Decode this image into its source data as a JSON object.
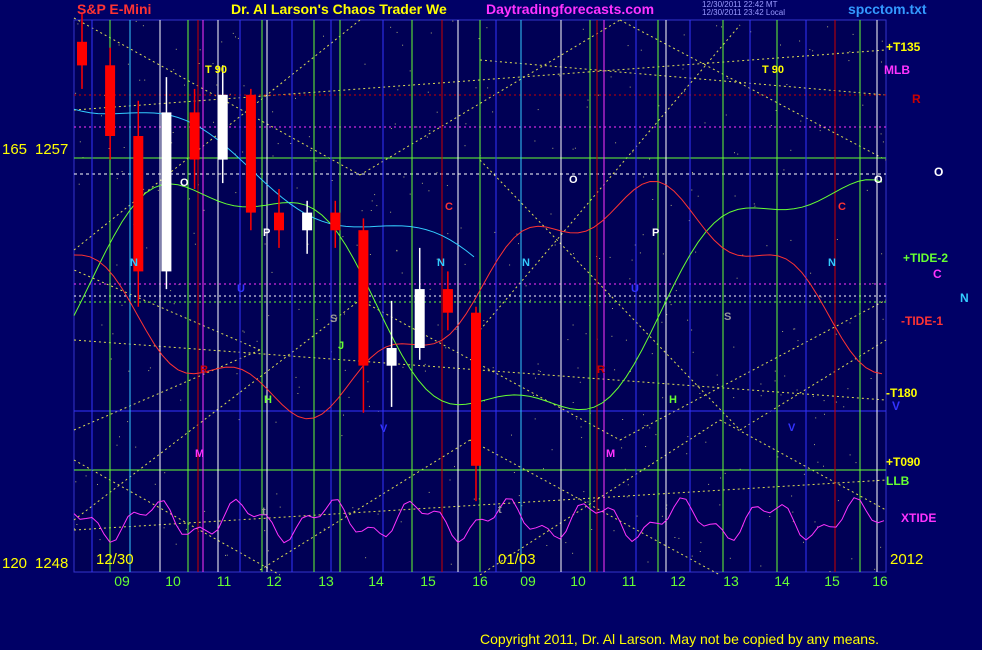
{
  "header": {
    "symbol": "S&P E-Mini",
    "title": "Dr. Al Larson's Chaos Trader We",
    "site": "Daytradingforecasts.com",
    "timestamp_1": "12/30/2011 22:42 MT",
    "timestamp_2": "12/30/2011 23:42 Local",
    "file": "spcctom.txt"
  },
  "y_axis": {
    "top_label_left": "165",
    "top_label_price": "1257",
    "bottom_label_left": "120",
    "bottom_label_price": "1248"
  },
  "footer": {
    "copyright": "Copyright 2011, Dr. Al Larson. May not be copied by any means."
  },
  "right_labels": {
    "t135": "+T135",
    "mlb": "MLB",
    "r": "R",
    "o": "O",
    "tide2": "+TIDE-2",
    "c": "C",
    "n": "N",
    "tide1": "-TIDE-1",
    "t180": "-T180",
    "v": "V",
    "t090": "+T090",
    "llb": "LLB",
    "xtide": "XTIDE"
  },
  "colors": {
    "background": "#000066",
    "plot_bg": "#000055",
    "axis_days": "#66ff33",
    "dates": "#ffff00",
    "header_red": "#ff3333",
    "header_yellow": "#ffff00",
    "header_magenta": "#ff33ff",
    "file_blue": "#3399ff"
  },
  "chart_data": {
    "type": "line",
    "title": "S&P E-Mini",
    "x_tick_labels": [
      "09",
      "10",
      "11",
      "12",
      "13",
      "14",
      "15",
      "16",
      "09",
      "10",
      "11",
      "12",
      "13",
      "14",
      "15",
      "16"
    ],
    "date_labels": [
      "12/30",
      "01/03",
      "2012"
    ],
    "y_range": [
      1248,
      1257
    ],
    "series": [
      {
        "name": "+TIDE-2"
      },
      {
        "name": "-TIDE-1"
      },
      {
        "name": "XTIDE"
      }
    ],
    "flux_line_labels": [
      "+T135",
      "MLB",
      "R",
      "O",
      "+TIDE-2",
      "C",
      "N",
      "-TIDE-1",
      "-T180",
      "V",
      "+T090",
      "LLB",
      "XTIDE"
    ],
    "cycle_letters_day1": [
      "T 90",
      "N",
      "U",
      "P",
      "S",
      "J",
      "R",
      "H",
      "M",
      "V",
      "t",
      "O",
      "C",
      "N"
    ],
    "cycle_letters_day2": [
      "T 90",
      "N",
      "U",
      "P",
      "S",
      "R",
      "H",
      "M",
      "V",
      "t",
      "O",
      "C",
      "N",
      "O"
    ],
    "price_bars": [
      {
        "t": "09:00",
        "o": 1256.8,
        "h": 1257.3,
        "l": 1256.0,
        "c": 1256.4
      },
      {
        "t": "09:30",
        "o": 1256.4,
        "h": 1256.7,
        "l": 1254.8,
        "c": 1255.2
      },
      {
        "t": "10:00",
        "o": 1255.2,
        "h": 1255.8,
        "l": 1252.3,
        "c": 1252.9
      },
      {
        "t": "10:30",
        "o": 1252.9,
        "h": 1256.2,
        "l": 1252.6,
        "c": 1255.6
      },
      {
        "t": "11:00",
        "o": 1255.6,
        "h": 1256.0,
        "l": 1254.3,
        "c": 1254.8
      },
      {
        "t": "11:30",
        "o": 1254.8,
        "h": 1256.4,
        "l": 1254.4,
        "c": 1255.9
      },
      {
        "t": "12:00",
        "o": 1255.9,
        "h": 1256.0,
        "l": 1253.6,
        "c": 1253.9
      },
      {
        "t": "12:30",
        "o": 1253.9,
        "h": 1254.3,
        "l": 1253.3,
        "c": 1253.6
      },
      {
        "t": "13:00",
        "o": 1253.6,
        "h": 1254.1,
        "l": 1253.2,
        "c": 1253.9
      },
      {
        "t": "13:30",
        "o": 1253.9,
        "h": 1254.1,
        "l": 1253.3,
        "c": 1253.6
      },
      {
        "t": "14:00",
        "o": 1253.6,
        "h": 1253.8,
        "l": 1250.5,
        "c": 1251.3
      },
      {
        "t": "14:30",
        "o": 1251.3,
        "h": 1252.4,
        "l": 1250.6,
        "c": 1251.6
      },
      {
        "t": "15:00",
        "o": 1251.6,
        "h": 1253.3,
        "l": 1251.4,
        "c": 1252.6
      },
      {
        "t": "15:30",
        "o": 1252.6,
        "h": 1252.9,
        "l": 1251.9,
        "c": 1252.2
      },
      {
        "t": "16:00",
        "o": 1252.2,
        "h": 1252.3,
        "l": 1249.0,
        "c": 1249.6
      }
    ]
  }
}
